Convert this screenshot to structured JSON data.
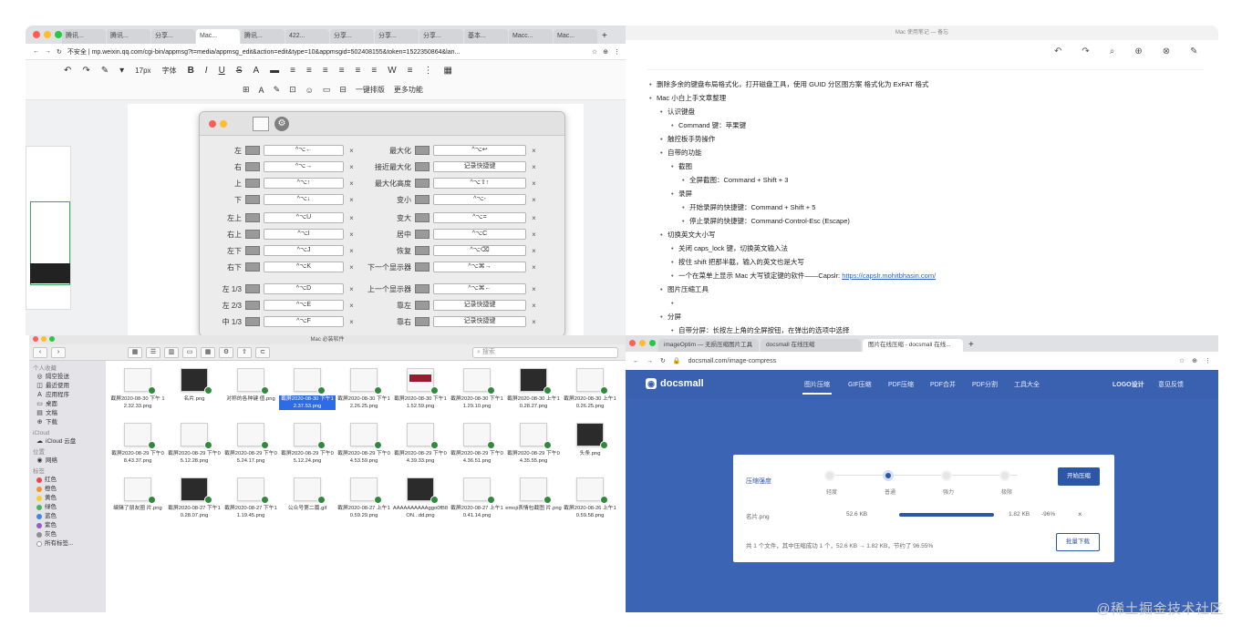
{
  "browser_top_left": {
    "tabs": [
      "腾讯...",
      "腾讯...",
      "分享...",
      "Mac...",
      "腾讯...",
      "422...",
      "分享...",
      "分享...",
      "分享...",
      "基本...",
      "Macc...",
      "Mac..."
    ],
    "new_tab": "+",
    "address": "不安全 | mp.weixin.qq.com/cgi-bin/appmsg?t=media/appmsg_edit&action=edit&type=10&appmsgid=502408155&token=1522350864&lan...",
    "toolbar1": [
      "↶",
      "↷",
      "✎",
      "▾",
      "17px",
      "字体",
      "B",
      "I",
      "U",
      "S",
      "A",
      "▬",
      "≡",
      "≡",
      "≡",
      "≡",
      "≡",
      "≡",
      "W",
      "≡",
      "⋮",
      "▦"
    ],
    "toolbar2": [
      "⊞",
      "A",
      "✎",
      "⊡",
      "☺",
      "▭",
      "⊟",
      "一键排版",
      "更多功能"
    ]
  },
  "magnet_panel": {
    "left_rows": [
      {
        "label": "左",
        "key": "^⌥←"
      },
      {
        "label": "右",
        "key": "^⌥→"
      },
      {
        "label": "上",
        "key": "^⌥↑"
      },
      {
        "label": "下",
        "key": "^⌥↓"
      },
      {
        "label": "左上",
        "key": "^⌥U"
      },
      {
        "label": "右上",
        "key": "^⌥I"
      },
      {
        "label": "左下",
        "key": "^⌥J"
      },
      {
        "label": "右下",
        "key": "^⌥K"
      },
      {
        "label": "左 1/3",
        "key": "^⌥D"
      },
      {
        "label": "左 2/3",
        "key": "^⌥E"
      },
      {
        "label": "中 1/3",
        "key": "^⌥F"
      }
    ],
    "right_rows": [
      {
        "label": "最大化",
        "key": "^⌥↩"
      },
      {
        "label": "接近最大化",
        "key": "记录快捷键"
      },
      {
        "label": "最大化高度",
        "key": "^⌥⇧↑"
      },
      {
        "label": "变小",
        "key": "^⌥-"
      },
      {
        "label": "变大",
        "key": "^⌥="
      },
      {
        "label": "居中",
        "key": "^⌥C"
      },
      {
        "label": "恢复",
        "key": "^⌥⌫"
      },
      {
        "label": "下一个显示器",
        "key": "^⌥⌘→"
      },
      {
        "label": "上一个显示器",
        "key": "^⌥⌘←"
      },
      {
        "label": "靠左",
        "key": "记录快捷键"
      },
      {
        "label": "靠右",
        "key": "记录快捷键"
      }
    ],
    "clear": "×"
  },
  "notes": {
    "window_title": "Mac 使用笔记 — 备忘",
    "toolbar": [
      "↶",
      "↷",
      "⌕",
      "⊕",
      "⊗",
      "✎",
      "?",
      "⋯"
    ],
    "lines": [
      {
        "text": "删除多余的键盘布局格式化，打开磁盘工具，使用 GUID 分区图方案 格式化为 ExFAT 格式",
        "level": 0
      },
      {
        "text": "Mac 小白上手文章整理",
        "level": 0
      },
      {
        "text": "认识键盘",
        "level": 1
      },
      {
        "text": "Command 键：苹果键",
        "level": 2
      },
      {
        "text": "触控板手势操作",
        "level": 1
      },
      {
        "text": "自带的功能",
        "level": 1
      },
      {
        "text": "截图",
        "level": 2
      },
      {
        "text": "全屏截图：Command + Shift + 3",
        "level": 3
      },
      {
        "text": "录屏",
        "level": 2
      },
      {
        "text": "开始录屏的快捷键：Command + Shift + 5",
        "level": 3
      },
      {
        "text": "停止录屏的快捷键：Command-Control-Esc (Escape)",
        "level": 3
      },
      {
        "text": "切换英文大小写",
        "level": 1
      },
      {
        "text": "关闭 caps_lock 键，切换英文输入法",
        "level": 2
      },
      {
        "text": "按住 shift 把那半截，输入的英文也是大写",
        "level": 2
      },
      {
        "text": "一个在菜单上显示 Mac 大写锁定键的软件——Capslr: ",
        "link": "https://capslr.mohitbhasin.com/",
        "level": 2
      },
      {
        "text": "图片压缩工具",
        "level": 1
      },
      {
        "text": "",
        "level": 2
      },
      {
        "text": "分屏",
        "level": 1
      },
      {
        "text": "自带分屏：长按左上角的全屏按钮，在弹出的选项中选择",
        "level": 2
      }
    ]
  },
  "finder": {
    "title": "Mac 必装软件",
    "back": "‹",
    "forward": "›",
    "view_buttons": [
      "▦",
      "☰",
      "▥",
      "▭",
      "▦",
      "⚙",
      "⇧",
      "⊂"
    ],
    "search_placeholder": "搜索",
    "sidebar": [
      {
        "type": "header",
        "label": "个人收藏"
      },
      {
        "type": "item",
        "icon": "◎",
        "label": "隔空投送"
      },
      {
        "type": "item",
        "icon": "◫",
        "label": "最近使用"
      },
      {
        "type": "item",
        "icon": "A",
        "label": "应用程序"
      },
      {
        "type": "item",
        "icon": "▭",
        "label": "桌面"
      },
      {
        "type": "item",
        "icon": "▤",
        "label": "文稿"
      },
      {
        "type": "item",
        "icon": "⊕",
        "label": "下载"
      },
      {
        "type": "header",
        "label": "iCloud"
      },
      {
        "type": "item",
        "icon": "☁",
        "label": "iCloud 云盘"
      },
      {
        "type": "header",
        "label": "位置"
      },
      {
        "type": "item",
        "icon": "◉",
        "label": "网络"
      },
      {
        "type": "header",
        "label": "标签"
      },
      {
        "type": "tag",
        "color": "#e5474b",
        "label": "红色"
      },
      {
        "type": "tag",
        "color": "#f2932f",
        "label": "橙色"
      },
      {
        "type": "tag",
        "color": "#f2d030",
        "label": "黄色"
      },
      {
        "type": "tag",
        "color": "#49b35a",
        "label": "绿色"
      },
      {
        "type": "tag",
        "color": "#3e86e6",
        "label": "蓝色"
      },
      {
        "type": "tag",
        "color": "#9a58c8",
        "label": "紫色"
      },
      {
        "type": "tag",
        "color": "#8e8e93",
        "label": "灰色"
      },
      {
        "type": "tag",
        "color": "#ffffff",
        "label": "所有标签..."
      }
    ],
    "files": [
      {
        "name": "截屏2020-08-30 下午 12.32.33.png",
        "style": "light"
      },
      {
        "name": "名片.png",
        "style": "dark"
      },
      {
        "name": "对称的各种键 值.png",
        "style": "light"
      },
      {
        "name": "截屏2020-08-30 下午12.37.53.png",
        "style": "light",
        "selected": true
      },
      {
        "name": "截屏2020-08-30 下午12.26.25.png",
        "style": "light"
      },
      {
        "name": "截屏2020-08-30 下午11.52.59.png",
        "style": "red"
      },
      {
        "name": "截屏2020-08-30 下午11.29.10.png",
        "style": "light"
      },
      {
        "name": "截屏2020-08-30 上午10.28.27.png",
        "style": "dark"
      },
      {
        "name": "截屏2020-08-30 上午10.26.25.png",
        "style": "light"
      },
      {
        "name": "截屏2020-08-29 下午08.43.37.png",
        "style": "light"
      },
      {
        "name": "截屏2020-08-29 下午05.12.28.png",
        "style": "light"
      },
      {
        "name": "截屏2020-08-29 下午05.24.17.png",
        "style": "light"
      },
      {
        "name": "截屏2020-08-29 下午05.12.24.png",
        "style": "light"
      },
      {
        "name": "截屏2020-08-29 下午04.53.59.png",
        "style": "light"
      },
      {
        "name": "截屏2020-08-29 下午04.39.33.png",
        "style": "light"
      },
      {
        "name": "截屏2020-08-29 下午04.36.51.png",
        "style": "light"
      },
      {
        "name": "截屏2020-08-29 下午04.35.55.png",
        "style": "light"
      },
      {
        "name": "头条.png",
        "style": "dark"
      },
      {
        "name": "编辑了朋友圈 片.png",
        "style": "light"
      },
      {
        "name": "截屏2020-08-27 下午10.28.07.png",
        "style": "dark"
      },
      {
        "name": "截屏2020-08-27 下午11.19.45.png",
        "style": "light"
      },
      {
        "name": "公众号第二篇.gif",
        "style": "light"
      },
      {
        "name": "截屏2020-08-27 上午10.59.29.png",
        "style": "light"
      },
      {
        "name": "AAAAAAAAAAggo0fB8ON...dd.png",
        "style": "dark"
      },
      {
        "name": "截屏2020-08-27 上午10.41.14.png",
        "style": "light"
      },
      {
        "name": "emoji表情包截图 片.png",
        "style": "light"
      },
      {
        "name": "截屏2020-08-26 上午10.59.58.png",
        "style": "light"
      }
    ]
  },
  "docsmall": {
    "tabs": [
      "imageOptim — 无损压缩图片工具",
      "docsmall 在线压缩",
      "图片在线压缩 - docsmall 在线..."
    ],
    "new_tab": "+",
    "address": "docsmall.com/image-compress",
    "logo": "docsmall",
    "nav": [
      "图片压缩",
      "GIF压缩",
      "PDF压缩",
      "PDF合并",
      "PDF分割",
      "工具大全"
    ],
    "nav_right": [
      "LOGO设计",
      "意见反馈"
    ],
    "card": {
      "title": "压缩强度",
      "steps": [
        "轻度",
        "普通",
        "强力",
        "极限"
      ],
      "start_button": "开始压缩",
      "file_name": "名片.png",
      "original_size": "52.6 KB",
      "new_size": "1.82 KB",
      "ratio": "-96%",
      "remove": "×",
      "summary": "共 1 个文件，其中压缩成功 1 个，52.6 KB → 1.82 KB，节约了 96.55%",
      "download_button": "批量下载"
    },
    "progress": 1.0
  },
  "watermark": "@稀土掘金技术社区"
}
